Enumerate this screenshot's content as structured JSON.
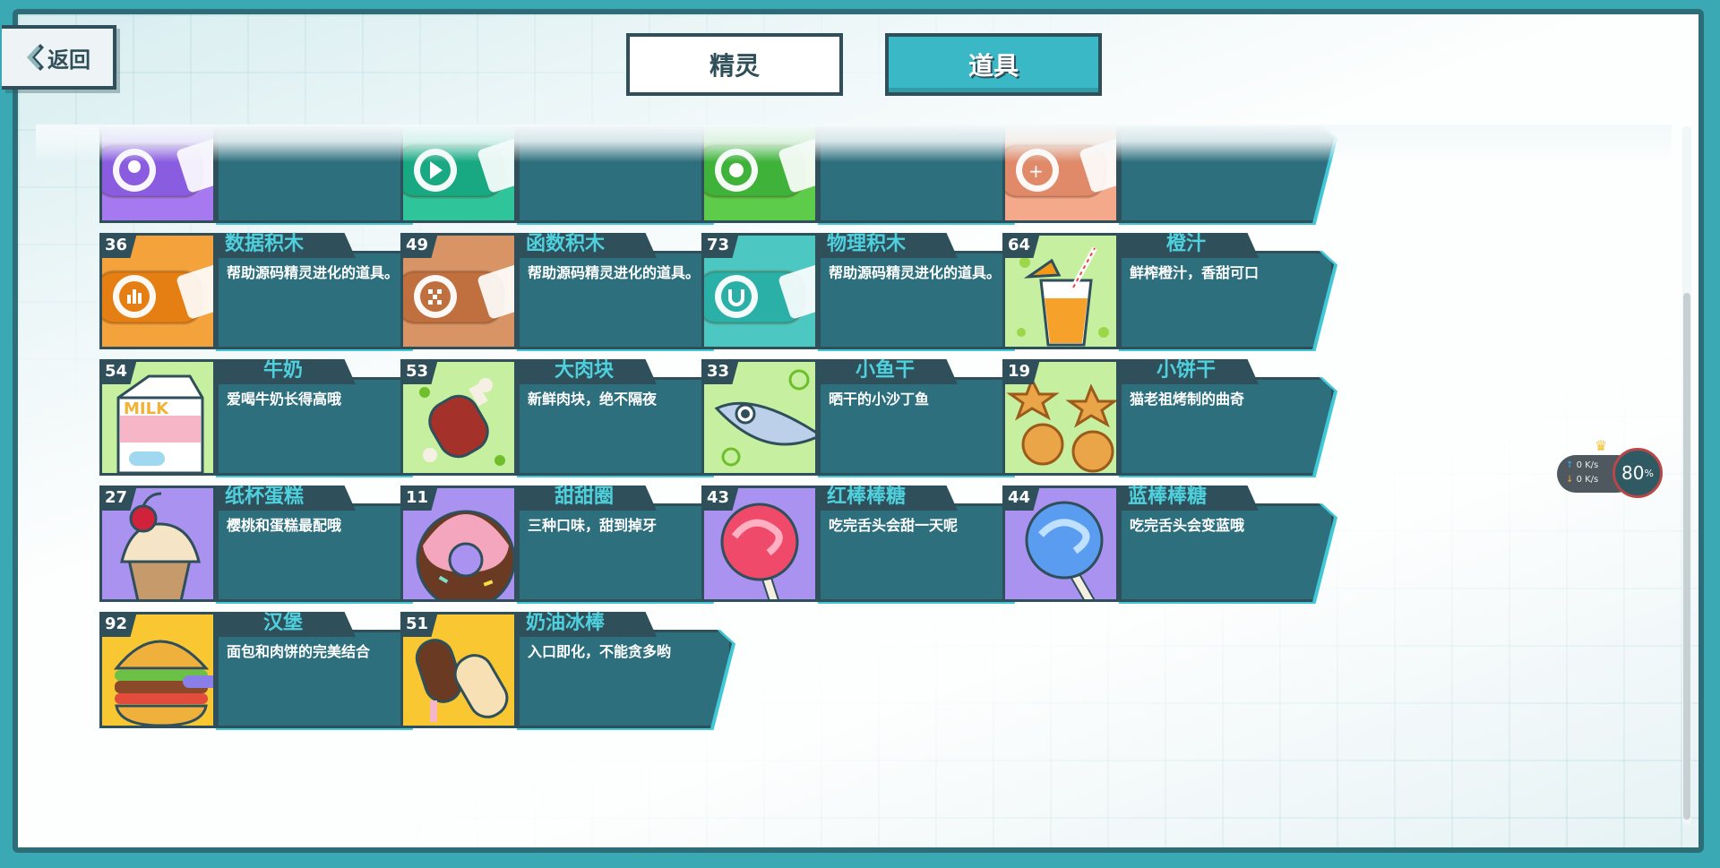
{
  "nav": {
    "back_label": "返回"
  },
  "tabs": [
    {
      "label": "精灵",
      "active": false
    },
    {
      "label": "道具",
      "active": true
    }
  ],
  "items": [
    {
      "count": "",
      "name": "",
      "desc": "",
      "icon": "sound-block-icon",
      "color": "#a779f0"
    },
    {
      "count": "",
      "name": "",
      "desc": "",
      "icon": "pen-block-icon",
      "color": "#2fc49a"
    },
    {
      "count": "",
      "name": "",
      "desc": "",
      "icon": "sensing-block-icon",
      "color": "#5ccc4a"
    },
    {
      "count": "",
      "name": "",
      "desc": "",
      "icon": "operator-block-icon",
      "color": "#f4a98a"
    },
    {
      "count": "36",
      "name": "数据积木",
      "desc": "帮助源码精灵进化的道具。",
      "icon": "data-block-icon",
      "color": "#f3a23c"
    },
    {
      "count": "49",
      "name": "函数积木",
      "desc": "帮助源码精灵进化的道具。",
      "icon": "procedure-block-icon",
      "color": "#d99466"
    },
    {
      "count": "73",
      "name": "物理积木",
      "desc": "帮助源码精灵进化的道具。",
      "icon": "physics-block-icon",
      "color": "#4dc7c1"
    },
    {
      "count": "64",
      "name": "橙汁",
      "desc": "鲜榨橙汁，香甜可口",
      "icon": "orange-juice-icon",
      "color": "#c6f0a0"
    },
    {
      "count": "54",
      "name": "牛奶",
      "desc": "爱喝牛奶长得高哦",
      "icon": "milk-icon",
      "color": "#c6f0a0"
    },
    {
      "count": "53",
      "name": "大肉块",
      "desc": "新鲜肉块，绝不隔夜",
      "icon": "meat-icon",
      "color": "#c6f0a0"
    },
    {
      "count": "33",
      "name": "小鱼干",
      "desc": "晒干的小沙丁鱼",
      "icon": "fish-icon",
      "color": "#c6f0a0"
    },
    {
      "count": "19",
      "name": "小饼干",
      "desc": "猫老祖烤制的曲奇",
      "icon": "cookie-icon",
      "color": "#c6f0a0"
    },
    {
      "count": "27",
      "name": "纸杯蛋糕",
      "desc": "樱桃和蛋糕最配哦",
      "icon": "cupcake-icon",
      "color": "#a992f0"
    },
    {
      "count": "11",
      "name": "甜甜圈",
      "desc": "三种口味，甜到掉牙",
      "icon": "donut-icon",
      "color": "#a992f0"
    },
    {
      "count": "43",
      "name": "红棒棒糖",
      "desc": "吃完舌头会甜一天呢",
      "icon": "red-lollipop-icon",
      "color": "#a992f0"
    },
    {
      "count": "44",
      "name": "蓝棒棒糖",
      "desc": "吃完舌头会变蓝哦",
      "icon": "blue-lollipop-icon",
      "color": "#a992f0"
    },
    {
      "count": "92",
      "name": "汉堡",
      "desc": "面包和肉饼的完美结合",
      "icon": "burger-icon",
      "color": "#f8c731"
    },
    {
      "count": "51",
      "name": "奶油冰棒",
      "desc": "入口即化，不能贪多哟",
      "icon": "ice-cream-icon",
      "color": "#f8c731"
    }
  ],
  "network": {
    "up": "0 K/s",
    "down": "0 K/s",
    "percent": "80",
    "percent_unit": "%"
  }
}
